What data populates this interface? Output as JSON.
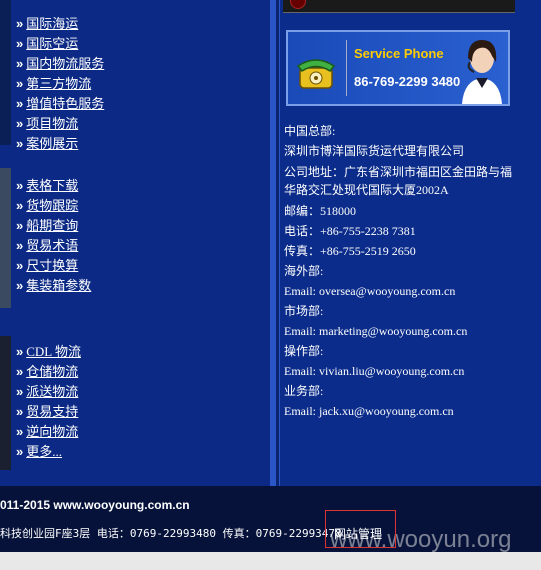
{
  "menu_group_1": [
    "国际海运",
    "国际空运",
    "国内物流服务",
    "第三方物流",
    "增值特色服务",
    "项目物流",
    "案例展示"
  ],
  "menu_group_2": [
    "表格下载",
    "货物跟踪",
    "船期查询",
    "贸易术语",
    "尺寸换算",
    "集装箱参数"
  ],
  "menu_group_3": [
    "CDL 物流",
    "仓储物流",
    "派送物流",
    "贸易支持",
    "逆向物流",
    "更多..."
  ],
  "service": {
    "title": "Service Phone",
    "number": "86-769-2299 3480"
  },
  "contact": {
    "hq_label": "中国总部:",
    "company": "深圳市博洋国际货运代理有限公司",
    "address": "公司地址：广东省深圳市福田区金田路与福华路交汇处现代国际大厦2002A",
    "postcode": "邮编：518000",
    "tel": "电话：+86-755-2238 7381",
    "fax": "传真：+86-755-2519 2650",
    "overseas_label": "海外部:",
    "overseas_email": "Email: oversea@wooyoung.com.cn",
    "marketing_label": "市场部:",
    "marketing_email": "Email: marketing@wooyoung.com.cn",
    "operations_label": "操作部:",
    "operations_email": "Email: vivian.liu@wooyoung.com.cn",
    "business_label": "业务部:",
    "business_email": "Email: jack.xu@wooyoung.com.cn"
  },
  "footer": {
    "copyright": "011-2015 www.wooyoung.com.cn",
    "address_line": "科技创业园F座3层 电话：0769-22993480 传真：0769-22993478",
    "admin_link": "网站管理"
  },
  "watermark": "www.wooyun.org",
  "bullet": "»"
}
